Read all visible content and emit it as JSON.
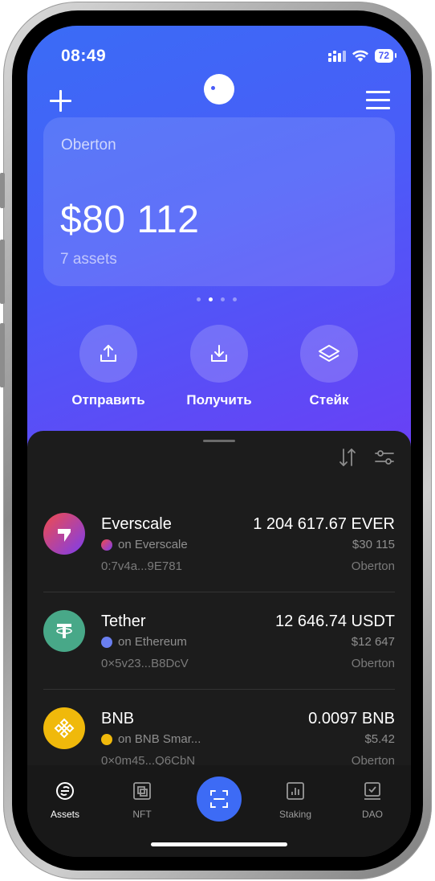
{
  "status_bar": {
    "time": "08:49",
    "battery": "72"
  },
  "wallet_card": {
    "name": "Oberton",
    "balance": "$80 112",
    "assets_count": "7 assets"
  },
  "actions": [
    {
      "label": "Отправить",
      "icon": "upload-icon"
    },
    {
      "label": "Получить",
      "icon": "download-icon"
    },
    {
      "label": "Стейк",
      "icon": "layers-icon"
    }
  ],
  "assets": [
    {
      "name": "Everscale",
      "network": "on Everscale",
      "address": "0:7v4a...9E781",
      "amount": "1 204 617.67 EVER",
      "fiat": "$30 115",
      "wallet": "Oberton",
      "icon": "everscale-icon",
      "color": "#7b3df0"
    },
    {
      "name": "Tether",
      "network": "on Ethereum",
      "address": "0×5v23...B8DcV",
      "amount": "12 646.74 USDT",
      "fiat": "$12 647",
      "wallet": "Oberton",
      "icon": "tether-icon",
      "color": "#48a888"
    },
    {
      "name": "BNB",
      "network": "on BNB Smar...",
      "address": "0×0m45...Q6CbN",
      "amount": "0.0097 BNB",
      "fiat": "$5.42",
      "wallet": "Oberton",
      "icon": "bnb-icon",
      "color": "#f0b90b"
    }
  ],
  "tabs": [
    {
      "label": "Assets",
      "icon": "assets-icon",
      "active": true
    },
    {
      "label": "NFT",
      "icon": "nft-icon"
    },
    {
      "label": "",
      "icon": "scan-icon"
    },
    {
      "label": "Staking",
      "icon": "staking-icon"
    },
    {
      "label": "DAO",
      "icon": "dao-icon"
    }
  ],
  "colors": {
    "accent": "#3d6bf5",
    "hero_start": "#3a6cf6",
    "hero_end": "#6a3ff5",
    "sheet": "#1c1c1c"
  }
}
